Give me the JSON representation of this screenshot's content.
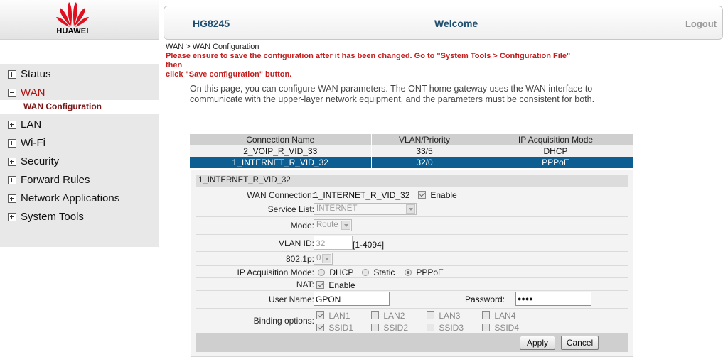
{
  "brand": {
    "logo_text": "HUAWEI",
    "logo_color": "#e01020"
  },
  "header": {
    "device": "HG8245",
    "welcome": "Welcome",
    "logout": "Logout"
  },
  "menu": {
    "items": [
      {
        "label": "Status",
        "expanded": false
      },
      {
        "label": "WAN",
        "expanded": true
      },
      {
        "label": "LAN",
        "expanded": false
      },
      {
        "label": "Wi-Fi",
        "expanded": false
      },
      {
        "label": "Security",
        "expanded": false
      },
      {
        "label": "Forward Rules",
        "expanded": false
      },
      {
        "label": "Network Applications",
        "expanded": false
      },
      {
        "label": "System Tools",
        "expanded": false
      }
    ],
    "submenu_active": "WAN Configuration"
  },
  "page": {
    "breadcrumb": "WAN > WAN Configuration",
    "notice_line1": "Please ensure to save the configuration after it has been changed. Go to \"System Tools > Configuration File\" then",
    "notice_line2": "click \"Save configuration\" button.",
    "intro_line1": "On this page, you can configure WAN parameters. The ONT home gateway uses the WAN interface to",
    "intro_line2": "communicate with the upper-layer network equipment, and the parameters must be consistent for both."
  },
  "table": {
    "headers": [
      "Connection Name",
      "VLAN/Priority",
      "IP Acquisition Mode"
    ],
    "rows": [
      [
        "2_VOIP_R_VID_33",
        "33/5",
        "DHCP"
      ],
      [
        "1_INTERNET_R_VID_32",
        "32/0",
        "PPPoE"
      ]
    ],
    "selected_row": 1
  },
  "form": {
    "title": "1_INTERNET_R_VID_32",
    "wan_connection_label": "WAN Connection:",
    "wan_connection_value": "1_INTERNET_R_VID_32",
    "enable_label": "Enable",
    "service_list_label": "Service List:",
    "service_list_value": "INTERNET",
    "mode_label": "Mode:",
    "mode_value": "Route",
    "vlan_id_label": "VLAN ID:",
    "vlan_id_value": "32",
    "vlan_id_range": "[1-4094]",
    "dot1p_label": "802.1p:",
    "dot1p_value": "0",
    "ip_mode_label": "IP Acquisition Mode:",
    "ip_mode_options": [
      "DHCP",
      "Static",
      "PPPoE"
    ],
    "ip_mode_selected": "PPPoE",
    "nat_label": "NAT:",
    "nat_enable_label": "Enable",
    "username_label": "User Name:",
    "username_value": "GPON",
    "password_label": "Password:",
    "password_value": "●●●●",
    "binding_label": "Binding options:",
    "binding_row1": [
      "LAN1",
      "LAN2",
      "LAN3",
      "LAN4"
    ],
    "binding_row2": [
      "SSID1",
      "SSID2",
      "SSID3",
      "SSID4"
    ],
    "binding_checked": [
      "LAN1",
      "SSID1"
    ]
  },
  "buttons": {
    "apply": "Apply",
    "cancel": "Cancel"
  }
}
